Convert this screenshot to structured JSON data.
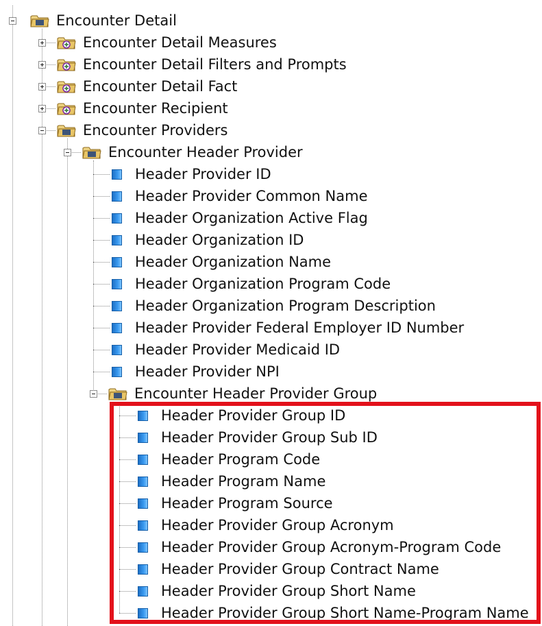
{
  "tree": {
    "root": {
      "label": "Encounter Detail",
      "icon": "cube-folder-icon",
      "state": "expanded"
    },
    "children": [
      {
        "label": "Encounter Detail Measures",
        "icon": "cube-folder-icon",
        "state": "collapsed"
      },
      {
        "label": "Encounter Detail Filters and Prompts",
        "icon": "cube-folder-icon",
        "state": "collapsed"
      },
      {
        "label": "Encounter Detail Fact",
        "icon": "cube-folder-icon",
        "state": "collapsed"
      },
      {
        "label": "Encounter Recipient",
        "icon": "cube-folder-icon",
        "state": "collapsed"
      },
      {
        "label": "Encounter Providers",
        "icon": "folder-icon",
        "state": "expanded"
      }
    ],
    "header_provider": {
      "label": "Encounter Header Provider",
      "icon": "folder-icon",
      "state": "expanded",
      "fields": [
        "Header Provider ID",
        "Header Provider Common Name",
        "Header Organization Active Flag",
        "Header Organization ID",
        "Header Organization Name",
        "Header Organization Program Code",
        "Header Organization Program Description",
        "Header Provider Federal Employer ID Number",
        "Header Provider Medicaid ID",
        "Header Provider NPI"
      ]
    },
    "provider_group": {
      "label": "Encounter Header Provider Group",
      "icon": "folder-icon",
      "state": "expanded",
      "fields": [
        "Header Provider Group ID",
        "Header Provider Group Sub ID",
        "Header Program Code",
        "Header Program Name",
        "Header Program Source",
        "Header Provider Group Acronym",
        "Header Provider Group Acronym-Program Code",
        "Header Provider Group Contract Name",
        "Header Provider Group Short Name",
        "Header Provider Group Short Name-Program Name"
      ]
    }
  },
  "colors": {
    "highlight": "#e3111b",
    "field_icon": "#2a86e0",
    "folder": "#d9b55a",
    "connector": "#8a8a8a"
  }
}
